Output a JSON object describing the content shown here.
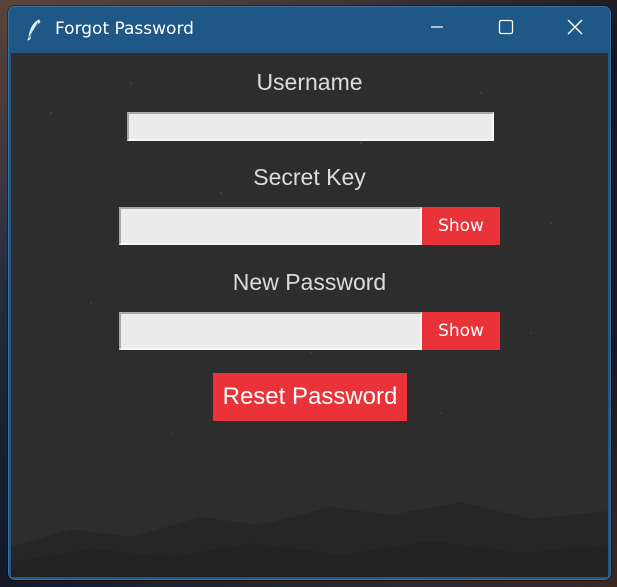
{
  "window": {
    "title": "Forgot Password",
    "icon": "feather-icon"
  },
  "titlebar_controls": [
    "minimize-icon",
    "maximize-icon",
    "close-icon"
  ],
  "form": {
    "username_label": "Username",
    "username_value": "",
    "secret_key_label": "Secret Key",
    "secret_key_value": "",
    "secret_key_show": "Show",
    "new_password_label": "New Password",
    "new_password_value": "",
    "new_password_show": "Show",
    "reset_button": "Reset Password"
  },
  "colors": {
    "titlebar": "#1f5787",
    "client_bg": "#2d2d2d",
    "accent_button": "#ea3338",
    "label_text": "#dcdcdc",
    "entry_bg": "#ececec"
  }
}
